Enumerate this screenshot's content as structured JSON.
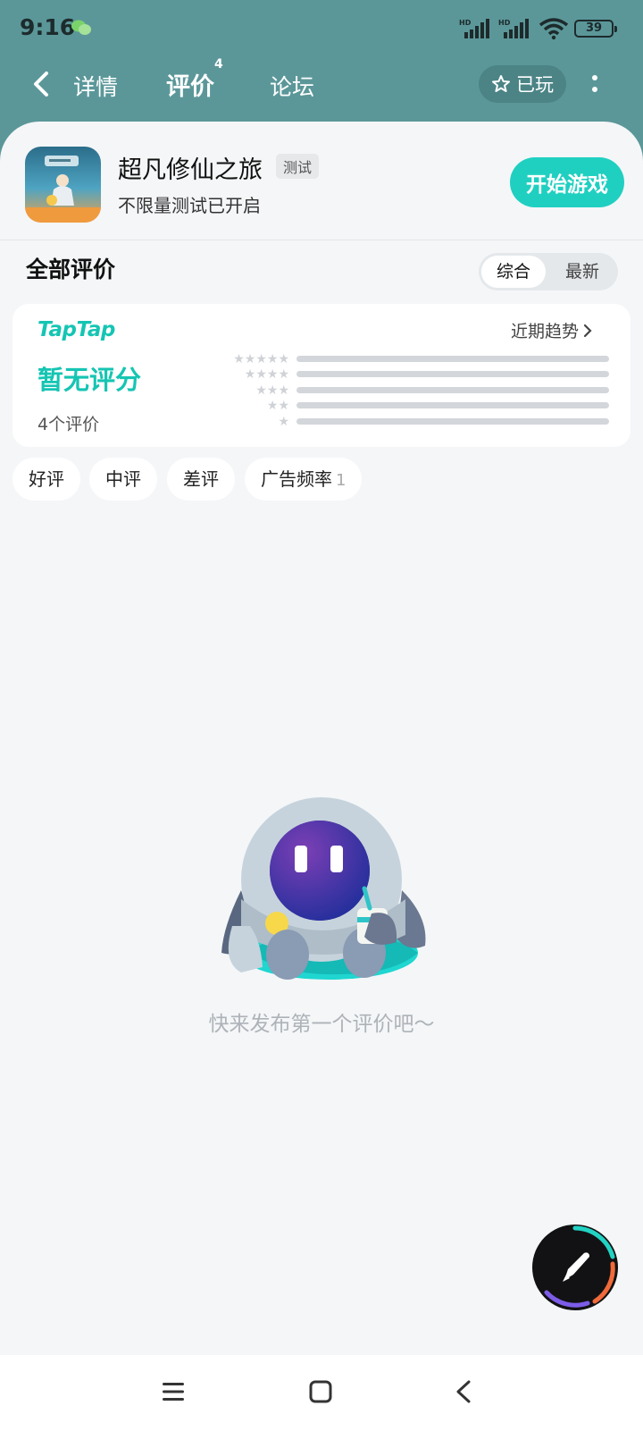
{
  "status": {
    "time": "9:16",
    "battery": "39"
  },
  "nav": {
    "tabs": [
      {
        "label": "详情"
      },
      {
        "label": "评价",
        "badge": "4"
      },
      {
        "label": "论坛"
      }
    ],
    "played_label": "已玩"
  },
  "game": {
    "title": "超凡修仙之旅",
    "tag": "测试",
    "subtitle": "不限量测试已开启",
    "start_label": "开始游戏"
  },
  "reviews": {
    "heading": "全部评价",
    "sort_options": [
      "综合",
      "最新"
    ],
    "brand": "TapTap",
    "score_text": "暂无评分",
    "count_text": "4个评价",
    "trend_label": "近期趋势",
    "star_rows": [
      5,
      4,
      3,
      2,
      1
    ],
    "filters": [
      {
        "label": "好评",
        "count": ""
      },
      {
        "label": "中评",
        "count": ""
      },
      {
        "label": "差评",
        "count": ""
      },
      {
        "label": "广告频率",
        "count": "1"
      }
    ]
  },
  "empty": {
    "message": "快来发布第一个评价吧～"
  },
  "colors": {
    "header": "#5b9799",
    "accent": "#1fd0c1",
    "brand": "#15c5b3"
  }
}
